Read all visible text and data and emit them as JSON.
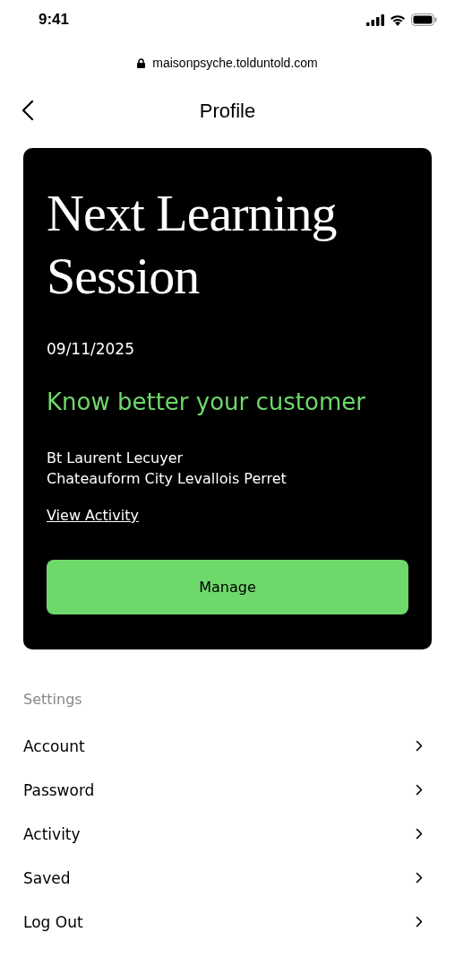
{
  "status_bar": {
    "time": "9:41"
  },
  "address_bar": {
    "url": "maisonpsyche.tolduntold.com"
  },
  "header": {
    "title": "Profile"
  },
  "session_card": {
    "title": "Next Learning Session",
    "date": "09/11/2025",
    "headline": "Know better your customer",
    "details": [
      "Bt Laurent Lecuyer",
      "Chateauform City Levallois Perret"
    ],
    "link": "View Activity",
    "button": "Manage"
  },
  "settings": {
    "heading": "Settings",
    "items": [
      {
        "label": "Account"
      },
      {
        "label": "Password"
      },
      {
        "label": "Activity"
      },
      {
        "label": "Saved"
      },
      {
        "label": "Log Out"
      }
    ]
  }
}
